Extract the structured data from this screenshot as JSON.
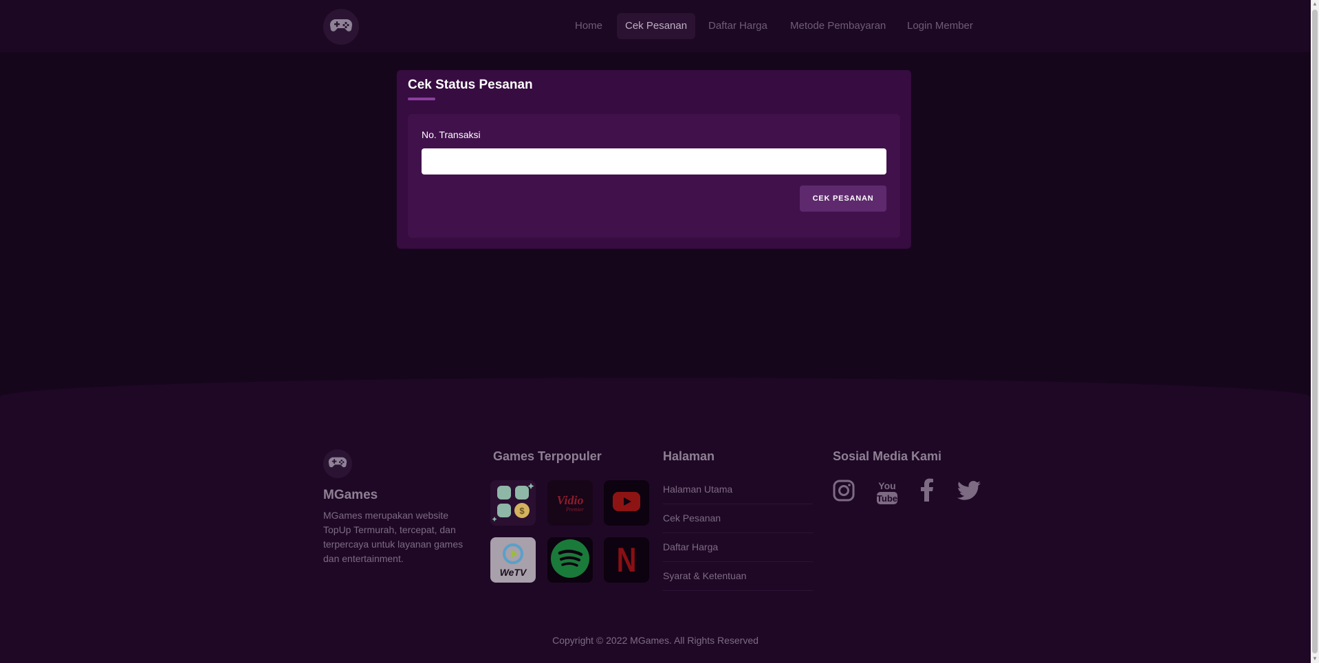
{
  "nav": {
    "logo_icon": "gamepad-icon",
    "items": [
      {
        "label": "Home",
        "active": false
      },
      {
        "label": "Cek Pesanan",
        "active": true
      },
      {
        "label": "Daftar Harga",
        "active": false
      },
      {
        "label": "Metode Pembayaran",
        "active": false
      },
      {
        "label": "Login Member",
        "active": false
      }
    ]
  },
  "order_check": {
    "title": "Cek Status Pesanan",
    "field_label": "No. Transaksi",
    "field_value": "",
    "button_label": "CEK PESANAN"
  },
  "footer": {
    "brand": "MGames",
    "description": "MGames merupakan website TopUp Termurah, tercepat, dan terpercaya untuk layanan games dan entertainment.",
    "games_heading": "Games Terpopuler",
    "games": [
      {
        "name": "topup-apps",
        "icon": "apps-coin-icon"
      },
      {
        "name": "vidio",
        "icon": "vidio-logo-icon",
        "text": "Vidio",
        "subtext": "Premier"
      },
      {
        "name": "youtube",
        "icon": "youtube-play-icon"
      },
      {
        "name": "wetv",
        "icon": "wetv-logo-icon",
        "text": "WeTV"
      },
      {
        "name": "spotify",
        "icon": "spotify-icon"
      },
      {
        "name": "netflix",
        "icon": "netflix-icon",
        "text": "N"
      }
    ],
    "pages_heading": "Halaman",
    "pages": [
      "Halaman Utama",
      "Cek Pesanan",
      "Daftar Harga",
      "Syarat & Ketentuan"
    ],
    "social_heading": "Sosial Media Kami",
    "social": [
      {
        "name": "instagram",
        "icon": "instagram-icon"
      },
      {
        "name": "youtube",
        "icon": "youtube-icon"
      },
      {
        "name": "facebook",
        "icon": "facebook-icon"
      },
      {
        "name": "twitter",
        "icon": "twitter-icon"
      }
    ],
    "copyright": "Copyright © 2022 MGames. All Rights Reserved"
  },
  "colors": {
    "page_bg": "#16061c",
    "header_bg": "#1c0823",
    "card_bg": "#370c40",
    "inner_bg": "#41114c",
    "button_bg": "#5e2a6d",
    "accent": "#8a3ea0"
  }
}
